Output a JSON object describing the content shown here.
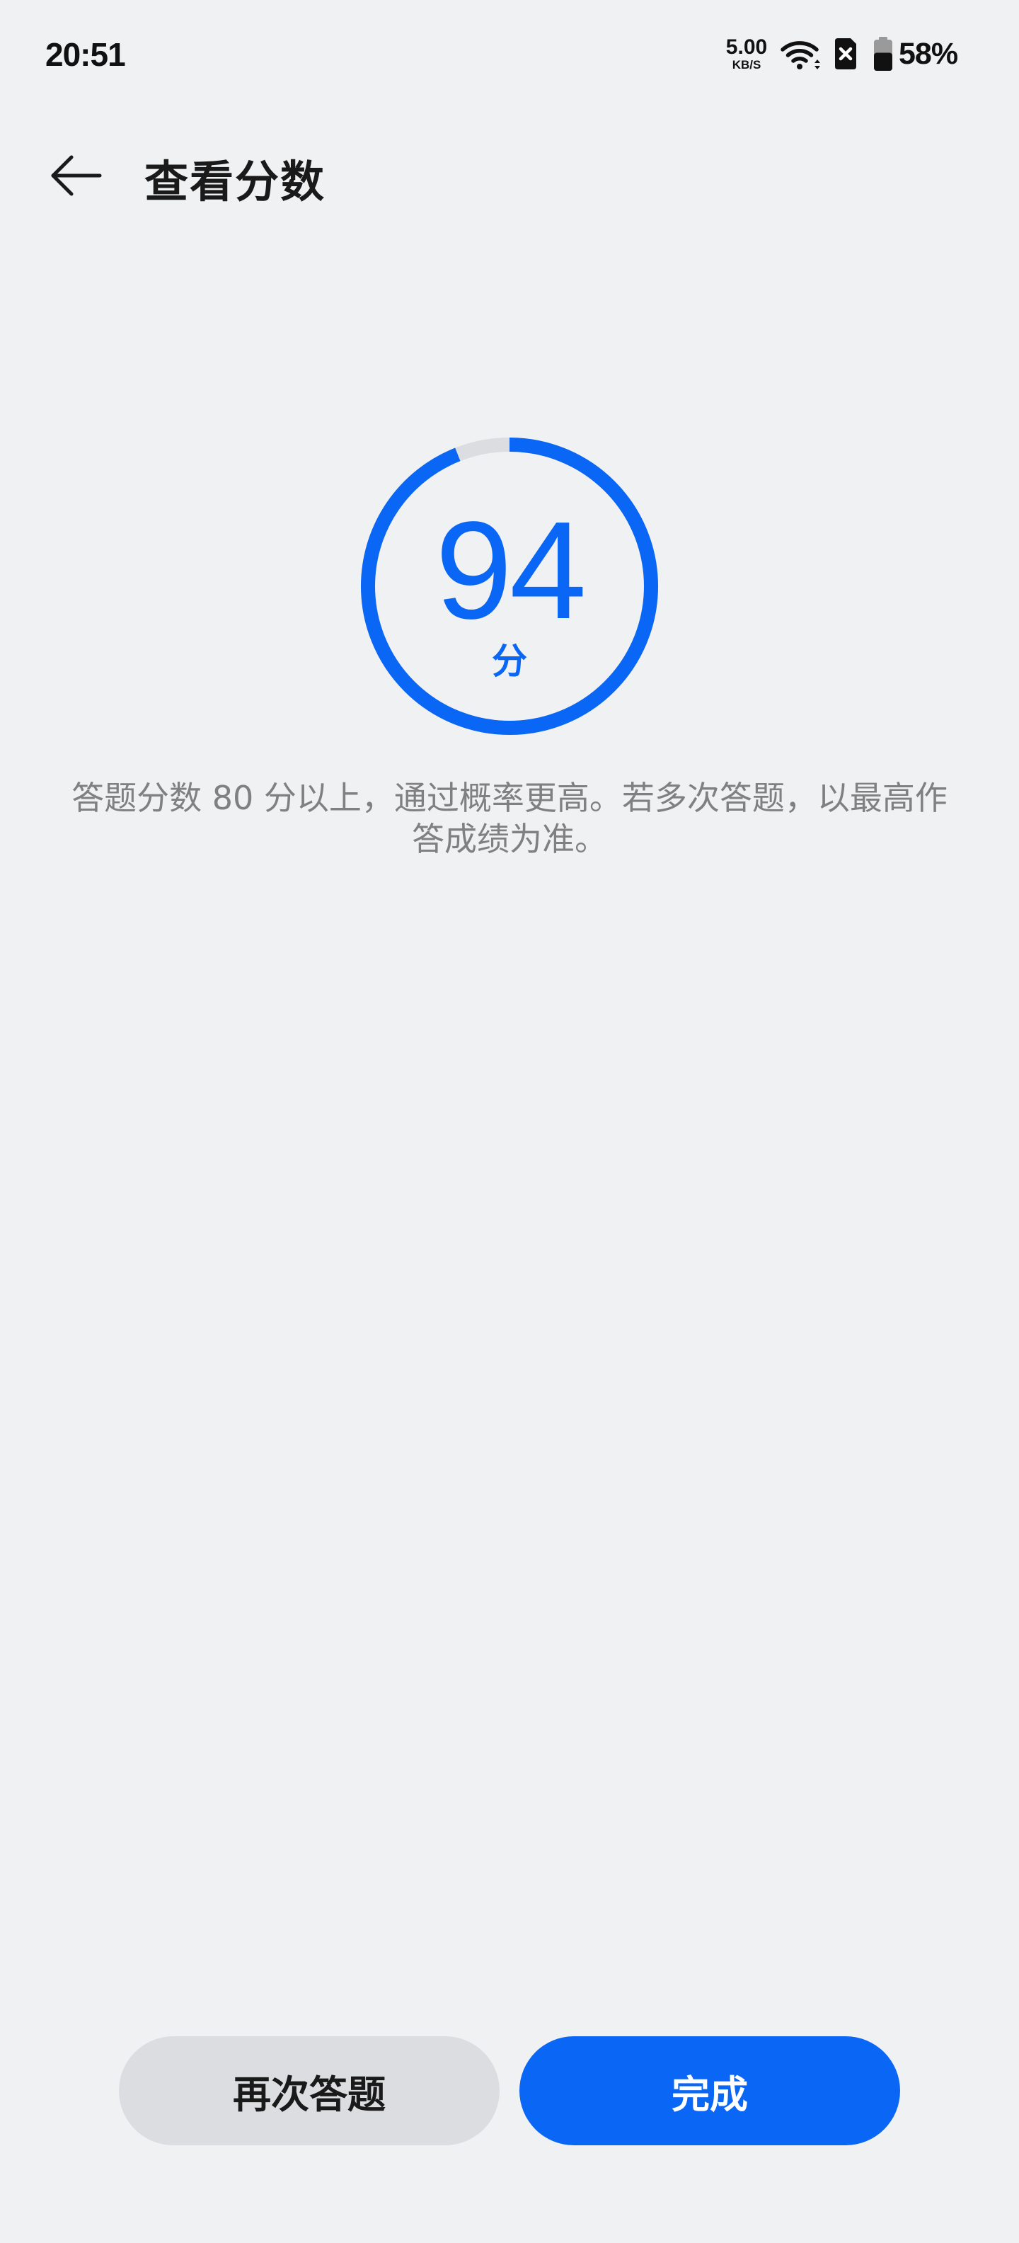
{
  "status_bar": {
    "time": "20:51",
    "net_speed_value": "5.00",
    "net_speed_unit": "KB/S",
    "battery_percent": "58%",
    "battery_level": 0.58,
    "icons": [
      "wifi-icon",
      "sim-disabled-icon",
      "battery-icon"
    ]
  },
  "header": {
    "back_icon": "back-arrow-icon",
    "title": "查看分数"
  },
  "score": {
    "value": "94",
    "unit": "分",
    "fraction": 0.94,
    "progress_color": "#0a66f5",
    "track_color": "#dcdde0"
  },
  "hint": {
    "text": "答题分数 80 分以上，通过概率更高。若多次答题，以最高作答成绩为准。"
  },
  "buttons": {
    "retry_label": "再次答题",
    "done_label": "完成"
  },
  "colors": {
    "accent": "#0a66f5",
    "background": "#f0f1f3",
    "secondary_button": "#dcdde0",
    "hint_text": "#808080"
  }
}
